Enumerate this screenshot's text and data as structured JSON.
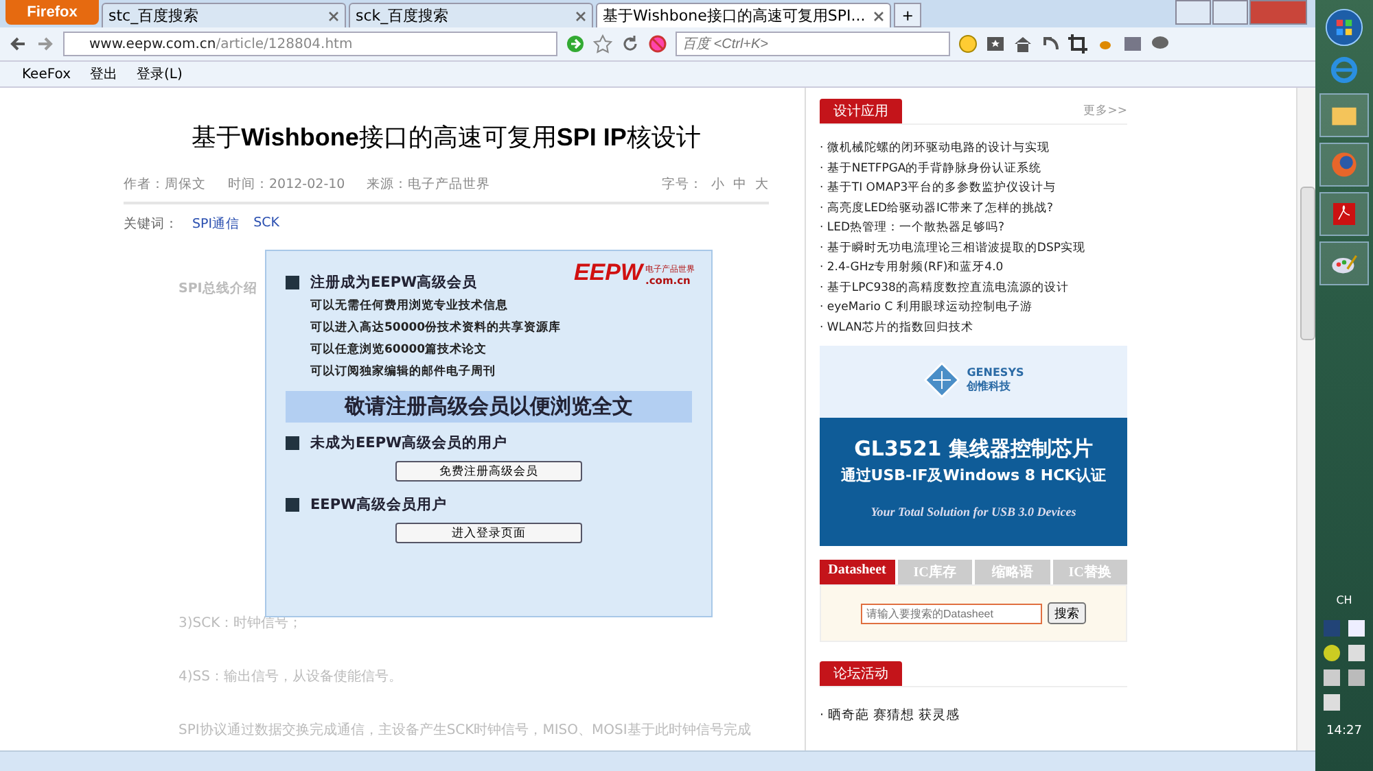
{
  "browser": {
    "menu_button": "Firefox",
    "tabs": [
      {
        "label": "stc_百度搜索",
        "selected": false
      },
      {
        "label": "sck_百度搜索",
        "selected": false
      },
      {
        "label": "基于Wishbone接口的高速可复用SPI...",
        "selected": true
      }
    ],
    "new_tab": "+",
    "url_host": "www.eepw.com.cn",
    "url_path": "/article/128804.htm",
    "search_placeholder": "百度 <Ctrl+K>",
    "bookmarks": [
      "KeeFox",
      "登出",
      "登录(L)"
    ]
  },
  "article": {
    "title": "基于**Wishbone**接口的高速可复用**SPI IP**核设计",
    "author": "作者：周保文",
    "time": "时间：2012-02-10",
    "source": "来源：电子产品世界",
    "font_size_label": "字号：",
    "font_sizes": [
      "小",
      "中",
      "大"
    ],
    "keywords_label": "关键词：",
    "keywords": [
      "SPI通信",
      "SCK"
    ],
    "section_heading": "SPI总线介绍",
    "body_lines": [
      "3)SCK：时钟信号；",
      "4)SS：输出信号，从设备使能信号。",
      "SPI协议通过数据交换完成通信，主设备产生SCK时钟信号，MISO、MOSI基于此时钟信号完成"
    ]
  },
  "overlay": {
    "logo": "EEPW",
    "logo_tagline": "电子产品世界",
    "logo_domain": ".com.cn",
    "register_heading": "注册成为EEPW高级会员",
    "benefits": [
      "可以无需任何费用浏览专业技术信息",
      "可以进入高达50000份技术资料的共享资源库",
      "可以任意浏览60000篇技术论文",
      "可以订阅独家编辑的邮件电子周刊"
    ],
    "notice": "敬请注册高级会员以便浏览全文",
    "guest_heading": "未成为EEPW高级会员的用户",
    "register_button": "免费注册高级会员",
    "member_heading": "EEPW高级会员用户",
    "login_button": "进入登录页面"
  },
  "sidebar": {
    "design_heading": "设计应用",
    "more_link": "更多>>",
    "design_items": [
      "· 微机械陀螺的闭环驱动电路的设计与实现",
      "· 基于NETFPGA的手背静脉身份认证系统",
      "· 基于TI OMAP3平台的多参数监护仪设计与",
      "· 高亮度LED给驱动器IC带来了怎样的挑战?",
      "· LED热管理：一个散热器足够吗?",
      "· 基于瞬时无功电流理论三相谐波提取的DSP实现",
      "· 2.4-GHz专用射频(RF)和蓝牙4.0",
      "· 基于LPC938的高精度数控直流电流源的设计",
      "· eyeMario C 利用眼球运动控制电子游",
      "· WLAN芯片的指数回归技术"
    ],
    "ad": {
      "brand_en": "GENESYS",
      "brand_cn": "创惟科技",
      "headline": "GL3521 集线器控制芯片",
      "subline": "通过USB-IF及Windows 8 HCK认证",
      "tagline": "Your Total Solution for USB 3.0 Devices"
    },
    "search_tabs": [
      {
        "label": "Datasheet",
        "selected": true
      },
      {
        "label": "IC库存",
        "selected": false
      },
      {
        "label": "缩略语",
        "selected": false
      },
      {
        "label": "IC替换",
        "selected": false
      }
    ],
    "search_placeholder": "请输入要搜索的Datasheet",
    "search_button": "搜索",
    "forum_heading": "论坛活动",
    "forum_items": [
      "· 晒奇葩 赛猜想 获灵感"
    ]
  },
  "taskbar": {
    "input_language": "CH",
    "clock": "14:27"
  }
}
